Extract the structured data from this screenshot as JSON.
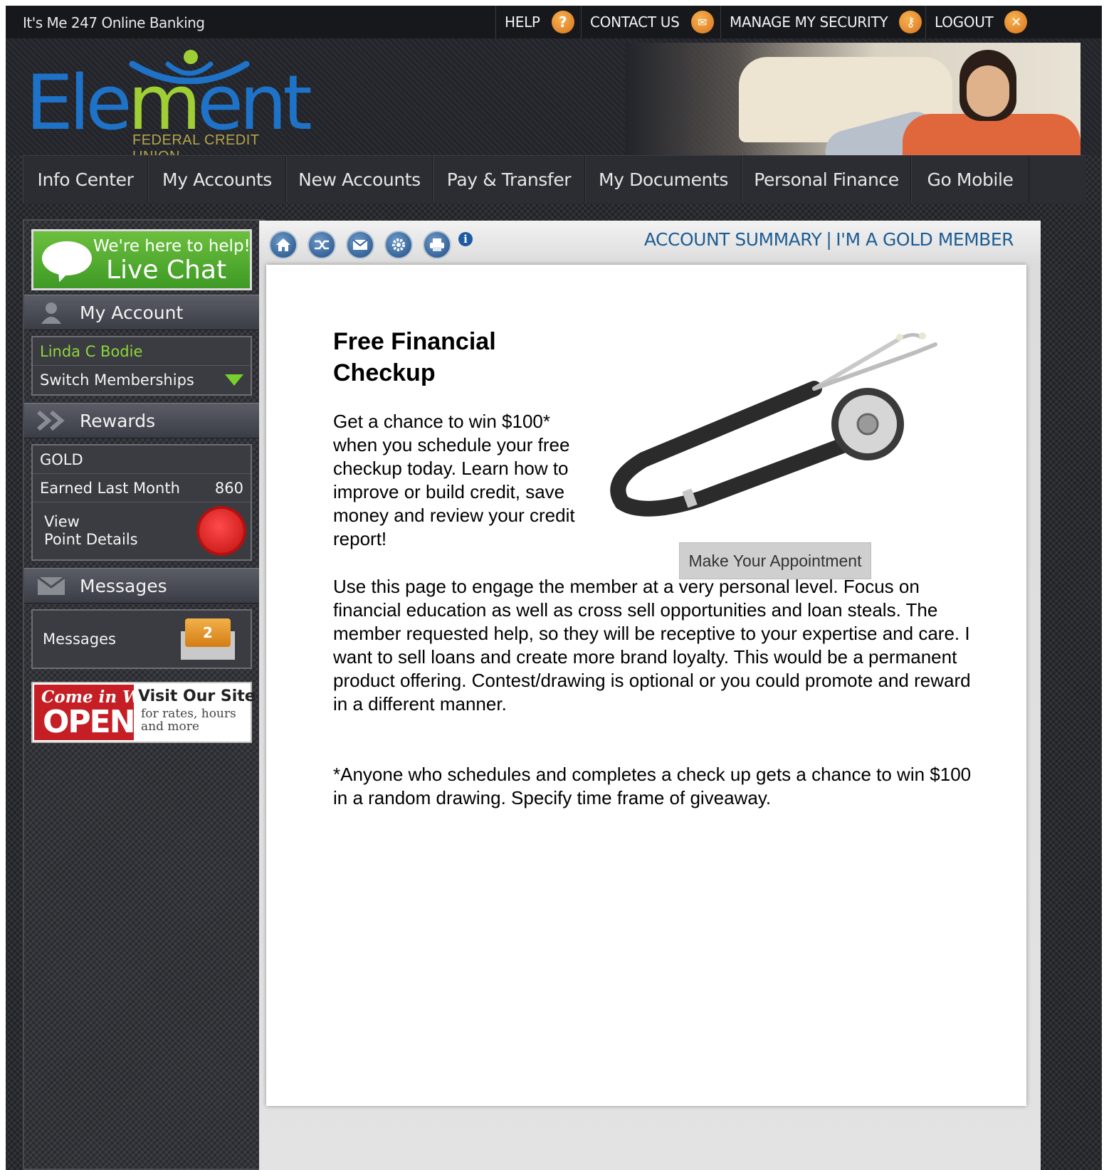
{
  "app": {
    "site_label": "It's Me 247 Online Banking"
  },
  "top_links": [
    {
      "label": "HELP",
      "icon": "help-icon",
      "glyph": "?"
    },
    {
      "label": "CONTACT US",
      "icon": "contact-icon",
      "glyph": "✉"
    },
    {
      "label": "MANAGE MY SECURITY",
      "icon": "security-key-icon",
      "glyph": "⚷"
    },
    {
      "label": "LOGOUT",
      "icon": "logout-icon",
      "glyph": "✕"
    }
  ],
  "logo": {
    "word_main": "Ele",
    "word_accent": "m",
    "word_tail": "ent",
    "subtitle": "FEDERAL CREDIT UNION"
  },
  "nav": [
    "Info Center",
    "My Accounts",
    "New Accounts",
    "Pay & Transfer",
    "My Documents",
    "Personal Finance",
    "Go Mobile"
  ],
  "sidebar": {
    "live_chat": {
      "line1": "We're here to help!",
      "line2": "Live Chat"
    },
    "my_account": {
      "heading": "My Account",
      "member_name": "Linda C Bodie",
      "switch_label": "Switch Memberships"
    },
    "rewards": {
      "heading": "Rewards",
      "tier": "GOLD",
      "earned_label": "Earned Last Month",
      "earned_value": "860",
      "view_line1": "View",
      "view_line2": "Point Details"
    },
    "messages": {
      "heading": "Messages",
      "label": "Messages",
      "count": "2"
    },
    "promo": {
      "come_in": "Come in We're",
      "open": "OPEN",
      "title": "Visit Our Site",
      "sub1": "for rates, hours",
      "sub2": "and more"
    }
  },
  "toolbar": {
    "icons": [
      "home-icon",
      "transfer-icon",
      "mail-icon",
      "settings-icon",
      "print-icon"
    ],
    "info_glyph": "i"
  },
  "breadcrumb": {
    "first": "ACCOUNT SUMMARY",
    "separator": "|",
    "second": "I'M A GOLD MEMBER"
  },
  "main": {
    "title": "Free Financial Checkup",
    "para1": "Get a chance to win $100* when you schedule your free checkup today. Learn how to improve or build credit, save money and review your credit report!",
    "para2": "Use this page to engage the member at a very personal level. Focus on financial education as well as cross sell opportunities and loan steals. The member requested help, so they will be receptive to your expertise and care. I want to sell loans and create more brand loyalty. This would be a permanent product offering. Contest/drawing is optional or you could promote and reward in a different manner.",
    "para3": "*Anyone who schedules and completes a check up gets a chance to win $100 in a random drawing. Specify time frame of giveaway.",
    "appointment_button": "Make Your Appointment"
  },
  "colors": {
    "brand_blue": "#1e73c8",
    "brand_green": "#9fcf35",
    "chat_green": "#4aa82c",
    "link_blue": "#1e5d93",
    "accent_orange": "#e38a26"
  }
}
